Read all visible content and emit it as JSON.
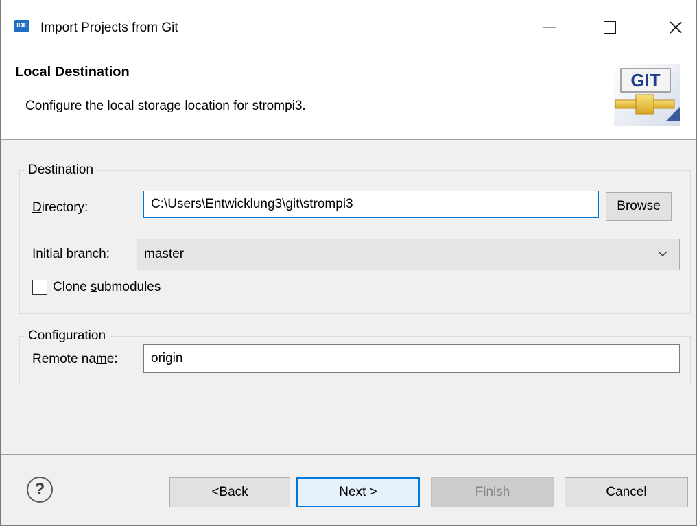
{
  "window": {
    "app_icon_text": "IDE",
    "title": "Import Projects from Git"
  },
  "header": {
    "title": "Local Destination",
    "description": "Configure the local storage location for strompi3.",
    "logo_text": "GIT"
  },
  "destination": {
    "group_label": "Destination",
    "directory_label_mnemonic": "D",
    "directory_label_rest": "irectory:",
    "directory_value": "C:\\Users\\Entwicklung3\\git\\strompi3",
    "browse_pre": "Bro",
    "browse_mnemonic": "w",
    "browse_post": "se",
    "branch_label_pre": "Initial branc",
    "branch_label_mnemonic": "h",
    "branch_label_post": ":",
    "branch_value": "master",
    "clone_pre": "Clone ",
    "clone_mnemonic": "s",
    "clone_post": "ubmodules",
    "clone_checked": false
  },
  "configuration": {
    "group_label": "Configuration",
    "remote_label_pre": "Remote na",
    "remote_label_mnemonic": "m",
    "remote_label_post": "e:",
    "remote_value": "origin"
  },
  "footer": {
    "help_glyph": "?",
    "back_pre": "< ",
    "back_mnemonic": "B",
    "back_post": "ack",
    "next_mnemonic": "N",
    "next_post": "ext >",
    "finish_mnemonic": "F",
    "finish_post": "inish",
    "cancel_label": "Cancel"
  },
  "colors": {
    "accent": "#0078d7",
    "header_bg": "#ffffff",
    "dialog_bg": "#f0f0f0"
  }
}
